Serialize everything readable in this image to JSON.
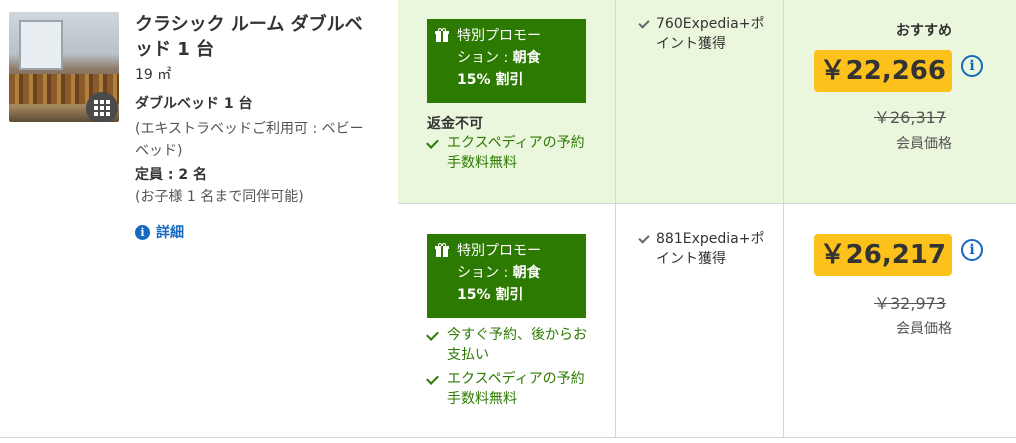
{
  "room": {
    "title": "クラシック ルーム ダブルベッド 1 台",
    "size": "19 ㎡",
    "bed_type": "ダブルベッド 1 台",
    "extra_bed": "(エキストラベッドご利用可 : ベビーベッド)",
    "occupancy": "定員 : 2 名",
    "children": "(お子様 1 名まで同伴可能)",
    "details_label": "詳細",
    "gallery_icon": "grid-icon"
  },
  "rates": [
    {
      "promo_line1": "特別プロモー",
      "promo_line2_prefix": "ション : ",
      "promo_line2_bold": "朝食",
      "promo_line3": "15% 割引",
      "refund": "返金不可",
      "features": [
        "エクスペディアの予約手数料無料"
      ],
      "points": "760Expedia+ポイント獲得",
      "recommend": "おすすめ",
      "price": "￥22,266",
      "strike_price": "￥26,317",
      "member_label": "会員価格"
    },
    {
      "promo_line1": "特別プロモー",
      "promo_line2_prefix": "ション : ",
      "promo_line2_bold": "朝食",
      "promo_line3": "15% 割引",
      "features": [
        "今すぐ予約、後からお支払い",
        "エクスペディアの予約手数料無料"
      ],
      "points": "881Expedia+ポイント獲得",
      "price": "￥26,217",
      "strike_price": "￥32,973",
      "member_label": "会員価格"
    }
  ],
  "colors": {
    "promo_green": "#2d7a02",
    "highlight_bg": "#ebf7dd",
    "price_badge": "#fcc21b",
    "link_blue": "#1668c1"
  }
}
